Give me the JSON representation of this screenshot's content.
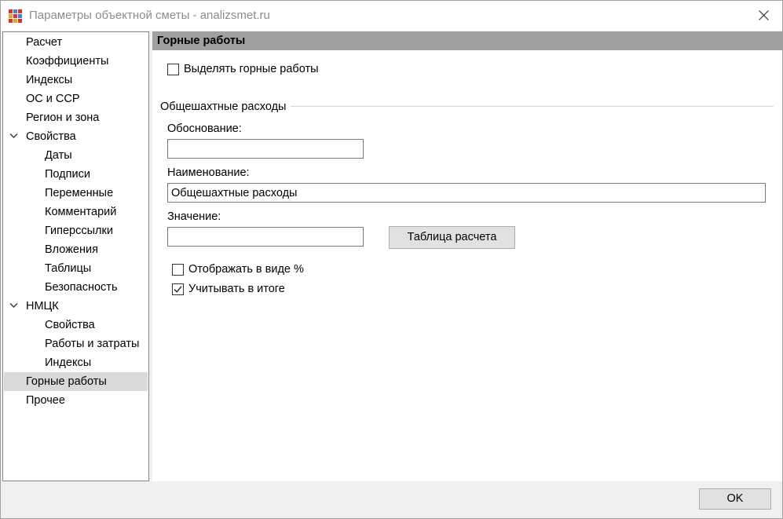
{
  "window": {
    "title": "Параметры объектной сметы - analizsmet.ru"
  },
  "tree": {
    "items": [
      {
        "label": "Расчет",
        "level": 0,
        "expanded": null,
        "selected": false
      },
      {
        "label": "Коэффициенты",
        "level": 0,
        "expanded": null,
        "selected": false
      },
      {
        "label": "Индексы",
        "level": 0,
        "expanded": null,
        "selected": false
      },
      {
        "label": "ОС и ССР",
        "level": 0,
        "expanded": null,
        "selected": false
      },
      {
        "label": "Регион и зона",
        "level": 0,
        "expanded": null,
        "selected": false
      },
      {
        "label": "Свойства",
        "level": 0,
        "expanded": true,
        "selected": false
      },
      {
        "label": "Даты",
        "level": 1,
        "expanded": null,
        "selected": false
      },
      {
        "label": "Подписи",
        "level": 1,
        "expanded": null,
        "selected": false
      },
      {
        "label": "Переменные",
        "level": 1,
        "expanded": null,
        "selected": false
      },
      {
        "label": "Комментарий",
        "level": 1,
        "expanded": null,
        "selected": false
      },
      {
        "label": "Гиперссылки",
        "level": 1,
        "expanded": null,
        "selected": false
      },
      {
        "label": "Вложения",
        "level": 1,
        "expanded": null,
        "selected": false
      },
      {
        "label": "Таблицы",
        "level": 1,
        "expanded": null,
        "selected": false
      },
      {
        "label": "Безопасность",
        "level": 1,
        "expanded": null,
        "selected": false
      },
      {
        "label": "НМЦК",
        "level": 0,
        "expanded": true,
        "selected": false
      },
      {
        "label": "Свойства",
        "level": 1,
        "expanded": null,
        "selected": false
      },
      {
        "label": "Работы и затраты",
        "level": 1,
        "expanded": null,
        "selected": false
      },
      {
        "label": "Индексы",
        "level": 1,
        "expanded": null,
        "selected": false
      },
      {
        "label": "Горные работы",
        "level": 0,
        "expanded": null,
        "selected": true
      },
      {
        "label": "Прочее",
        "level": 0,
        "expanded": null,
        "selected": false
      }
    ]
  },
  "panel": {
    "header": "Горные работы",
    "highlight_checkbox": {
      "label": "Выделять горные работы",
      "checked": false
    },
    "group_title": "Общешахтные расходы",
    "justification": {
      "label": "Обоснование:",
      "value": ""
    },
    "name": {
      "label": "Наименование:",
      "value": "Общешахтные расходы"
    },
    "value": {
      "label": "Значение:",
      "value": ""
    },
    "calc_table_button": "Таблица расчета",
    "show_percent_checkbox": {
      "label": "Отображать в виде %",
      "checked": false
    },
    "include_total_checkbox": {
      "label": "Учитывать в итоге",
      "checked": true
    }
  },
  "footer": {
    "ok_button": "OK"
  },
  "colors": {
    "panel_header_bg": "#a0a0a0",
    "selected_item_bg": "#d9d9d9"
  }
}
